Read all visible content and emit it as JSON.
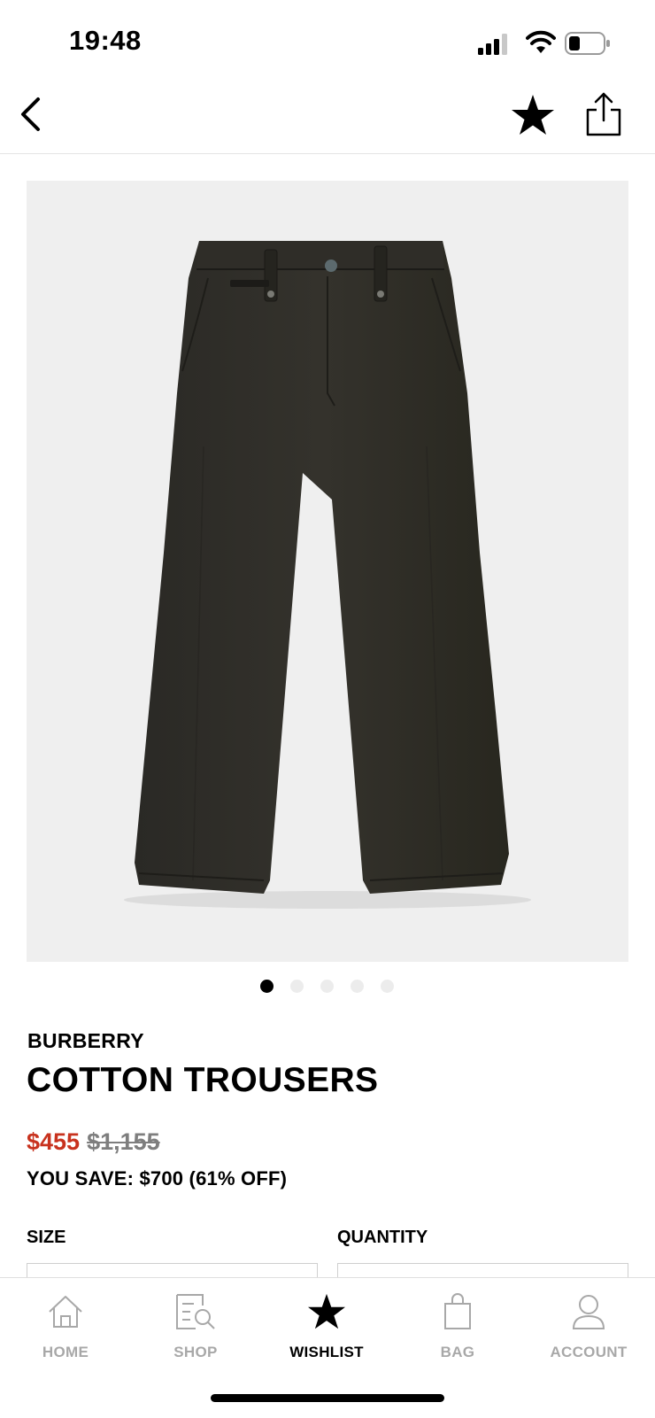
{
  "status_bar": {
    "time": "19:48"
  },
  "product": {
    "brand": "BURBERRY",
    "name": "COTTON TROUSERS",
    "sale_price": "$455",
    "original_price": "$1,155",
    "savings": "YOU SAVE: $700 (61% OFF)",
    "image_count": 5,
    "active_image_index": 0
  },
  "options": {
    "size_label": "SIZE",
    "quantity_label": "QUANTITY"
  },
  "tabs": [
    {
      "label": "HOME",
      "icon": "home-icon",
      "active": false
    },
    {
      "label": "SHOP",
      "icon": "shop-icon",
      "active": false
    },
    {
      "label": "WISHLIST",
      "icon": "star-icon",
      "active": true
    },
    {
      "label": "BAG",
      "icon": "bag-icon",
      "active": false
    },
    {
      "label": "ACCOUNT",
      "icon": "account-icon",
      "active": false
    }
  ],
  "colors": {
    "sale_price": "#c8321e",
    "strikethrough_price": "#7e7e7e",
    "inactive_tab": "#a8a8a8",
    "image_background": "#efefef",
    "trousers": "#2e2c27"
  }
}
